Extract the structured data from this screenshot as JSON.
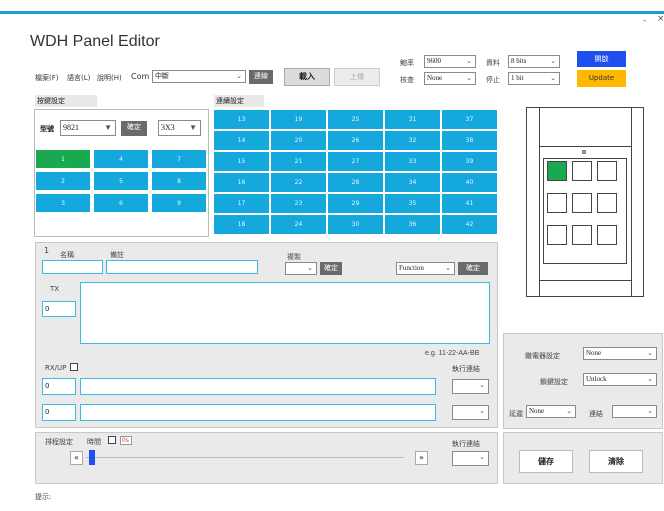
{
  "app": {
    "title": "WDH Panel Editor",
    "minimize": "-",
    "close": "×"
  },
  "menu": {
    "file": "檔案(F)",
    "language": "語言(L)",
    "help": "說明(H)",
    "com_label": "Com",
    "com_value": "中斷",
    "connect": "連線",
    "load": "載入",
    "upload": "上傳"
  },
  "serial": {
    "baud_label": "鮑率",
    "baud_value": "9600",
    "data_label": "資料",
    "data_value": "8 bits",
    "parity_label": "核查",
    "parity_value": "None",
    "stop_label": "停止",
    "stop_value": "1 bit",
    "open_button": "開啟",
    "update_button": "Update"
  },
  "key_settings": {
    "section_title": "按鍵設定",
    "model_label": "型號",
    "model_value": "9821",
    "confirm": "確定",
    "layout_value": "3X3",
    "cells": [
      "1",
      "4",
      "7",
      "2",
      "5",
      "8",
      "3",
      "6",
      "9"
    ]
  },
  "continuous_settings": {
    "section_title": "連續設定",
    "rows": [
      [
        "13",
        "19",
        "25",
        "31",
        "37"
      ],
      [
        "14",
        "20",
        "26",
        "32",
        "38"
      ],
      [
        "15",
        "21",
        "27",
        "33",
        "39"
      ],
      [
        "16",
        "22",
        "28",
        "34",
        "40"
      ],
      [
        "17",
        "23",
        "29",
        "35",
        "41"
      ],
      [
        "18",
        "24",
        "30",
        "36",
        "42"
      ]
    ]
  },
  "editor": {
    "index": "1",
    "name_label": "名稱",
    "note_label": "備註",
    "copy_label": "複製",
    "copy_confirm": "確定",
    "function_value": "Function",
    "function_confirm": "確定",
    "tx_label": "TX",
    "tx_count": "0",
    "example": "e.g. 11-22-AA-BB",
    "exec_label": "執行連結",
    "rx_label": "RX/UP",
    "rx_count_1": "0",
    "rx_count_2": "0"
  },
  "schedule": {
    "label": "排程設定",
    "time_label": "時間",
    "time_value": "0s",
    "prev": "«",
    "next": "»",
    "exec_label": "執行連結"
  },
  "right_panel": {
    "relay_label": "繼電器設定",
    "relay_value": "None",
    "lock_label": "鎖鍵設定",
    "lock_value": "Unlock",
    "delay_label": "延遲",
    "delay_value": "None",
    "link_label": "連結",
    "save": "儲存",
    "clear": "清除"
  },
  "status": {
    "hint_label": "提示:"
  }
}
